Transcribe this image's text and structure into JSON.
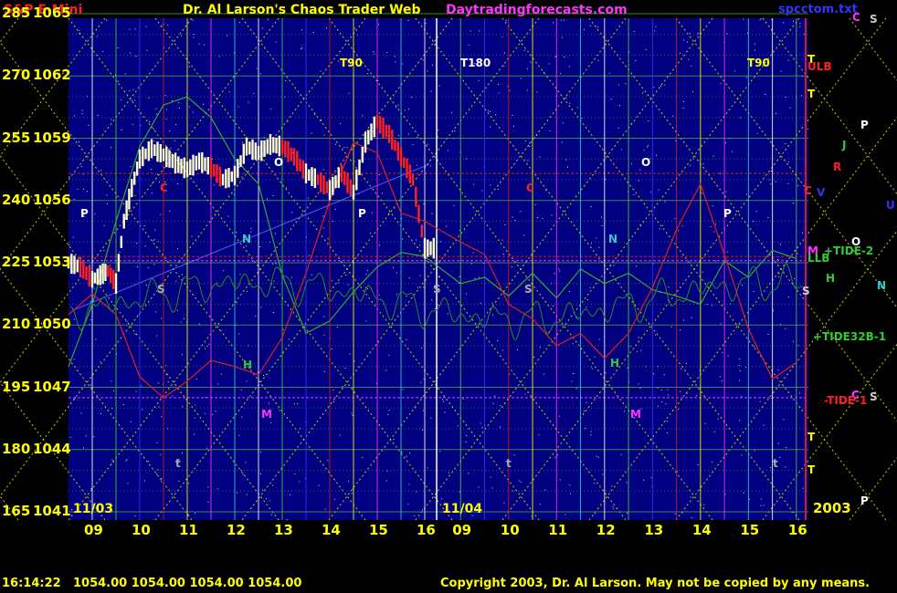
{
  "header": {
    "title": "S&P E-Mini",
    "subtitle": "Dr. Al Larson's Chaos Trader Web",
    "site": "Daytradingforecasts.com",
    "file": "spcctom.txt"
  },
  "status": {
    "time": "16:14:22",
    "quote": "1054.00 1054.00 1054.00 1054.00",
    "copyright": "Copyright 2003, Dr. Al Larson. May not be copied by any means."
  },
  "colors": {
    "background": "#000080",
    "price_bar": "#ffffcc",
    "price_down": "#ff2020",
    "tide_green": "#33aa33",
    "red_curve": "#dd2020",
    "grid_yellow": "#cccc00",
    "grid_red": "#cc2020"
  },
  "chart_data": {
    "type": "line",
    "title": "S&P E-Mini",
    "ylim": [
      1041,
      1065
    ],
    "left_scale": [
      "285",
      "270",
      "255",
      "240",
      "225",
      "210",
      "195",
      "180",
      "165"
    ],
    "price_ticks": [
      "1065",
      "1062",
      "1059",
      "1056",
      "1053",
      "1050",
      "1047",
      "1044",
      "1041"
    ],
    "x_ticks": [
      "09",
      "10",
      "11",
      "12",
      "13",
      "14",
      "15",
      "16",
      "09",
      "10",
      "11",
      "12",
      "13",
      "14",
      "15",
      "16"
    ],
    "date_labels": [
      "11/03",
      "11/04",
      "2003"
    ],
    "top_labels": [
      "T90",
      "T180",
      "T90"
    ],
    "right_labels": [
      {
        "text": "C",
        "color": "#ff33ff"
      },
      {
        "text": "S",
        "color": "#cccccc"
      },
      {
        "text": "T",
        "color": "#ffff00"
      },
      {
        "text": "ULB",
        "color": "#ff2020"
      },
      {
        "text": "T",
        "color": "#ffff00"
      },
      {
        "text": "P",
        "color": "#ffffff"
      },
      {
        "text": "J",
        "color": "#33cc33"
      },
      {
        "text": "R",
        "color": "#ff2020"
      },
      {
        "text": "C",
        "color": "#ff2020"
      },
      {
        "text": "V",
        "color": "#3333ff"
      },
      {
        "text": "U",
        "color": "#3333ff"
      },
      {
        "text": "O",
        "color": "#ffffff"
      },
      {
        "text": "M",
        "color": "#ff33ff"
      },
      {
        "text": "+TIDE-2",
        "color": "#33cc33"
      },
      {
        "text": "LLB",
        "color": "#33cc33"
      },
      {
        "text": "H",
        "color": "#33cc33"
      },
      {
        "text": "N",
        "color": "#33cccc"
      },
      {
        "text": "S",
        "color": "#cccccc"
      },
      {
        "text": "+TIDE32B-1",
        "color": "#33cc33"
      },
      {
        "text": "C",
        "color": "#ff33ff"
      },
      {
        "text": "S",
        "color": "#cccccc"
      },
      {
        "text": "-TIDE-1",
        "color": "#ff2020"
      },
      {
        "text": "T",
        "color": "#ffff00"
      },
      {
        "text": "T",
        "color": "#ffff00"
      },
      {
        "text": "P",
        "color": "#ffffff"
      }
    ],
    "inline_labels": [
      {
        "text": "C",
        "color": "#ff2020"
      },
      {
        "text": "P",
        "color": "#ffffff"
      },
      {
        "text": "N",
        "color": "#33cccc"
      },
      {
        "text": "O",
        "color": "#ffffff"
      },
      {
        "text": "S",
        "color": "#aaaaaa"
      },
      {
        "text": "H",
        "color": "#33cc33"
      },
      {
        "text": "M",
        "color": "#ff33ff"
      },
      {
        "text": "t",
        "color": "#aaaaaa"
      },
      {
        "text": "P",
        "color": "#ffffff"
      },
      {
        "text": "S",
        "color": "#aaaaaa"
      },
      {
        "text": "C",
        "color": "#ff2020"
      },
      {
        "text": "S",
        "color": "#aaaaaa"
      },
      {
        "text": "O",
        "color": "#ffffff"
      },
      {
        "text": "N",
        "color": "#33cccc"
      },
      {
        "text": "H",
        "color": "#33cc33"
      },
      {
        "text": "M",
        "color": "#ff33ff"
      },
      {
        "text": "t",
        "color": "#aaaaaa"
      },
      {
        "text": "P",
        "color": "#ffffff"
      },
      {
        "text": "t",
        "color": "#aaaaaa"
      }
    ],
    "series": [
      {
        "values": [
          [
            "11/03 08:30",
            1053.0
          ],
          [
            "11/03 08:45",
            1052.8
          ],
          [
            "11/03 09:00",
            1052.2
          ],
          [
            "11/03 09:10",
            1052.4
          ],
          [
            "11/03 09:20",
            1052.6
          ],
          [
            "11/03 09:30",
            1052.0
          ],
          [
            "11/03 09:40",
            1055.0
          ],
          [
            "11/03 09:50",
            1056.6
          ],
          [
            "11/03 10:00",
            1058.0
          ],
          [
            "11/03 10:15",
            1058.5
          ],
          [
            "11/03 10:30",
            1058.2
          ],
          [
            "11/03 10:45",
            1057.8
          ],
          [
            "11/03 11:00",
            1057.5
          ],
          [
            "11/03 11:15",
            1057.9
          ],
          [
            "11/03 11:30",
            1057.6
          ],
          [
            "11/03 11:45",
            1057.0
          ],
          [
            "11/03 12:00",
            1057.2
          ],
          [
            "11/03 12:15",
            1058.6
          ],
          [
            "11/03 12:30",
            1058.3
          ],
          [
            "11/03 12:45",
            1058.7
          ],
          [
            "11/03 13:00",
            1058.6
          ],
          [
            "11/03 13:15",
            1058.1
          ],
          [
            "11/03 13:30",
            1057.3
          ],
          [
            "11/03 13:45",
            1057.0
          ],
          [
            "11/03 14:00",
            1056.5
          ],
          [
            "11/03 14:15",
            1057.3
          ],
          [
            "11/03 14:30",
            1056.4
          ],
          [
            "11/03 14:45",
            1058.8
          ],
          [
            "11/03 15:00",
            1059.8
          ],
          [
            "11/03 15:15",
            1059.2
          ],
          [
            "11/03 15:30",
            1058.1
          ],
          [
            "11/03 15:45",
            1057.0
          ],
          [
            "11/03 16:00",
            1053.7
          ],
          [
            "11/03 16:15",
            1053.7
          ]
        ]
      },
      {
        "values": [
          [
            "11/03 08:30",
            1048.0
          ],
          [
            "11/03 09:00",
            1051.0
          ],
          [
            "11/03 09:30",
            1055.0
          ],
          [
            "11/03 10:00",
            1058.6
          ],
          [
            "11/03 10:30",
            1060.6
          ],
          [
            "11/03 11:00",
            1061.0
          ],
          [
            "11/03 11:30",
            1060.0
          ],
          [
            "11/03 12:00",
            1058.0
          ],
          [
            "11/03 12:30",
            1056.8
          ],
          [
            "11/03 13:00",
            1052.4
          ],
          [
            "11/03 13:30",
            1049.6
          ],
          [
            "11/03 14:00",
            1050.2
          ],
          [
            "11/03 14:30",
            1051.6
          ],
          [
            "11/03 15:00",
            1052.8
          ],
          [
            "11/03 15:30",
            1053.5
          ],
          [
            "11/03 16:00",
            1053.3
          ],
          [
            "11/04 09:00",
            1052.0
          ],
          [
            "11/04 09:30",
            1052.3
          ],
          [
            "11/04 10:00",
            1051.4
          ],
          [
            "11/04 10:30",
            1052.5
          ],
          [
            "11/04 11:00",
            1051.3
          ],
          [
            "11/04 11:30",
            1052.7
          ],
          [
            "11/04 12:00",
            1052.0
          ],
          [
            "11/04 12:30",
            1052.5
          ],
          [
            "11/04 13:00",
            1051.7
          ],
          [
            "11/04 13:30",
            1051.4
          ],
          [
            "11/04 14:00",
            1051.0
          ],
          [
            "11/04 14:30",
            1053.1
          ],
          [
            "11/04 15:00",
            1052.3
          ],
          [
            "11/04 15:30",
            1053.6
          ],
          [
            "11/04 16:00",
            1053.2
          ]
        ]
      },
      {
        "values": [
          [
            "11/03 08:30",
            1050.5
          ],
          [
            "11/03 09:00",
            1051.5
          ],
          [
            "11/03 09:30",
            1050.5
          ],
          [
            "11/03 10:00",
            1047.5
          ],
          [
            "11/03 10:30",
            1046.5
          ],
          [
            "11/03 11:00",
            1047.3
          ],
          [
            "11/03 11:30",
            1048.3
          ],
          [
            "11/03 12:00",
            1048.0
          ],
          [
            "11/03 12:30",
            1047.6
          ],
          [
            "11/03 13:00",
            1049.4
          ],
          [
            "11/03 13:30",
            1052.5
          ],
          [
            "11/03 14:00",
            1056.0
          ],
          [
            "11/03 14:30",
            1058.8
          ],
          [
            "11/03 15:00",
            1058.3
          ],
          [
            "11/03 15:30",
            1055.4
          ],
          [
            "11/03 16:00",
            1055.0
          ],
          [
            "11/04 09:00",
            1054.0
          ],
          [
            "11/04 09:30",
            1053.4
          ],
          [
            "11/04 10:00",
            1051.0
          ],
          [
            "11/04 10:30",
            1050.3
          ],
          [
            "11/04 11:00",
            1049.0
          ],
          [
            "11/04 11:30",
            1049.6
          ],
          [
            "11/04 12:00",
            1048.4
          ],
          [
            "11/04 12:30",
            1049.6
          ],
          [
            "11/04 13:00",
            1051.8
          ],
          [
            "11/04 13:30",
            1054.6
          ],
          [
            "11/04 14:00",
            1056.8
          ],
          [
            "11/04 14:30",
            1053.4
          ],
          [
            "11/04 15:00",
            1049.8
          ],
          [
            "11/04 15:30",
            1047.4
          ],
          [
            "11/04 16:00",
            1048.2
          ]
        ]
      }
    ]
  }
}
